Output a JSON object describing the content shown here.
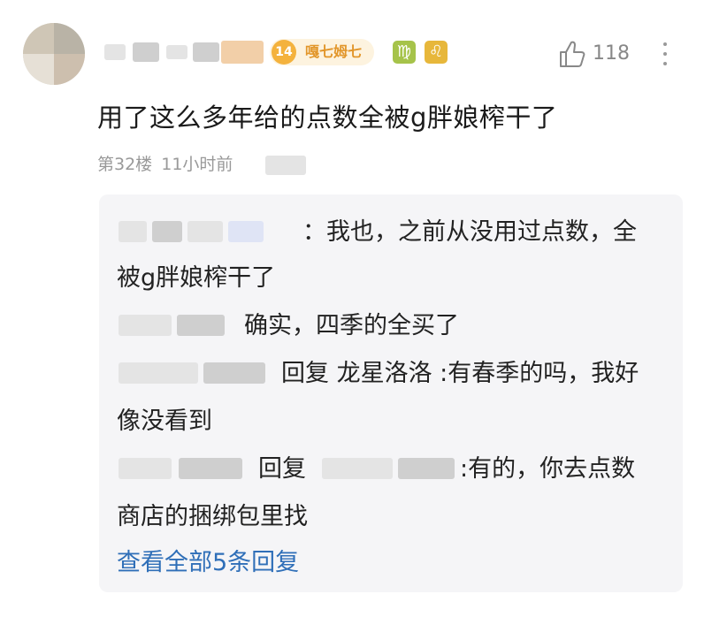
{
  "header": {
    "level_badge": {
      "level": "14",
      "title": "嘎七姆七"
    },
    "zodiac_badges": [
      {
        "glyph": "♍",
        "color": "#a6c34a"
      },
      {
        "glyph": "♌",
        "color": "#e7b73b"
      }
    ],
    "like_count": "118"
  },
  "comment": {
    "text": "用了这么多年给的点数全被g胖娘榨干了",
    "floor": "第32楼",
    "time": "11小时前"
  },
  "replies": {
    "lines": [
      "：我也，之前从没用过点数，全",
      "被g胖娘榨干了",
      "确实，四季的全买了",
      "回复 龙星洛洛 :有春季的吗，我好",
      "像没看到",
      "回复",
      ":有的，你去点数",
      "商店的捆绑包里找"
    ],
    "view_all": "查看全部5条回复"
  },
  "colors": {
    "link": "#2f6fb8",
    "badge_bg": "#fdf3df",
    "badge_accent": "#f4b23d",
    "reply_bg": "#f5f5f7"
  }
}
